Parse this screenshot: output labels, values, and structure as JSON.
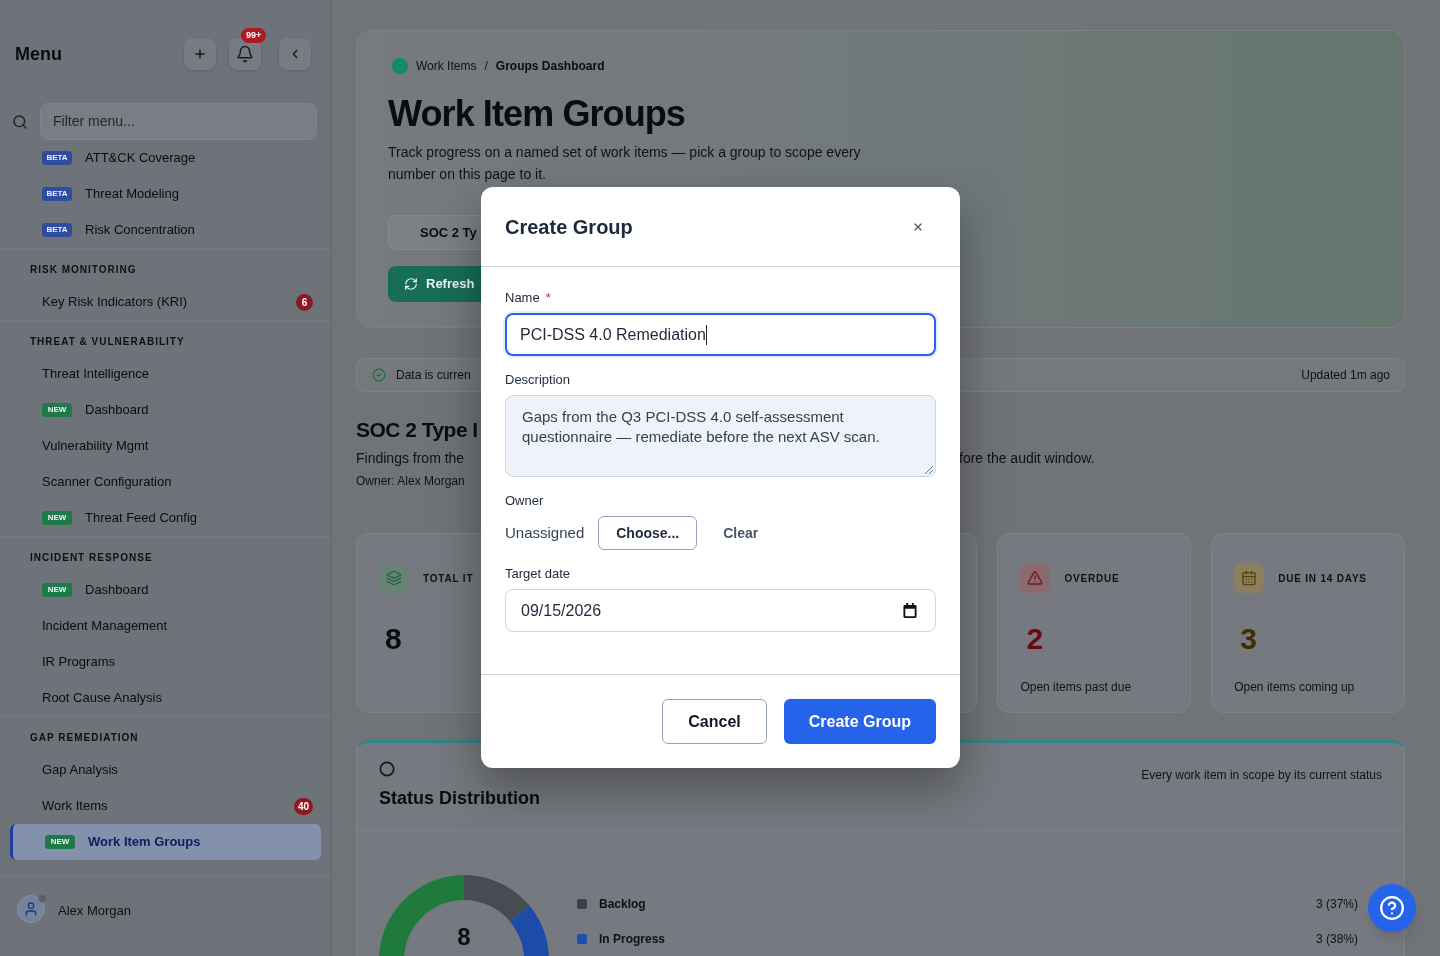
{
  "sidebar": {
    "title": "Menu",
    "notification_count": "99+",
    "filter": {
      "placeholder": "Filter menu..."
    },
    "sections": [
      {
        "items": [
          {
            "label": "ATT&CK Coverage",
            "tag": {
              "text": "BETA",
              "color": "#2f4d9f"
            },
            "selected": false
          },
          {
            "label": "Threat Modeling",
            "tag": {
              "text": "BETA",
              "color": "#2f4d9f"
            },
            "selected": false
          },
          {
            "label": "Risk Concentration",
            "tag": {
              "text": "BETA",
              "color": "#2f4d9f"
            },
            "selected": false
          }
        ]
      },
      {
        "heading": "RISK MONITORING",
        "items": [
          {
            "label": "Key Risk Indicators (KRI)",
            "count": "6",
            "selected": false
          }
        ]
      },
      {
        "heading": "THREAT & VULNERABILITY",
        "items": [
          {
            "label": "Threat Intelligence",
            "selected": false
          },
          {
            "label": "Dashboard",
            "tag": {
              "text": "NEW",
              "color": "#1e7a48"
            },
            "selected": false
          },
          {
            "label": "Vulnerability Mgmt",
            "selected": false
          },
          {
            "label": "Scanner Configuration",
            "selected": false
          },
          {
            "label": "Threat Feed Config",
            "tag": {
              "text": "NEW",
              "color": "#1e7a48"
            },
            "selected": false
          }
        ]
      },
      {
        "heading": "INCIDENT RESPONSE",
        "items": [
          {
            "label": "Dashboard",
            "tag": {
              "text": "NEW",
              "color": "#1e7a48"
            },
            "selected": false
          },
          {
            "label": "Incident Management",
            "selected": false
          },
          {
            "label": "IR Programs",
            "selected": false
          },
          {
            "label": "Root Cause Analysis",
            "selected": false
          }
        ]
      },
      {
        "heading": "GAP REMEDIATION",
        "items": [
          {
            "label": "Gap Analysis",
            "selected": false
          },
          {
            "label": "Work Items",
            "count": "40",
            "selected": false
          },
          {
            "label": "Work Item Groups",
            "tag": {
              "text": "NEW",
              "color": "#1e7a48"
            },
            "selected": true
          }
        ]
      }
    ],
    "user": {
      "name": "Alex Morgan"
    }
  },
  "main": {
    "breadcrumb": {
      "items": [
        "Work Items",
        "Groups Dashboard"
      ],
      "separator": "/"
    },
    "title": "Work Item Groups",
    "description": "Track progress on a named set of work items — pick a group to scope every number on this page to it.",
    "group_select": {
      "value": "SOC 2 Ty"
    },
    "refresh_button": {
      "label": "Refresh"
    },
    "status": {
      "message": "Data is curren",
      "updated": "Updated 1m ago"
    },
    "group": {
      "title": "SOC 2 Type I",
      "description_start": "Findings from the",
      "description_end": "fore the audit window.",
      "owner": "Owner: Alex Morgan"
    },
    "stat_cards": [
      {
        "kind": "total",
        "label": "TOTAL IT",
        "value": "8"
      },
      {
        "kind": "overdue",
        "label": "OVERDUE",
        "value": "2",
        "caption": "Open items past due"
      },
      {
        "kind": "due_soon",
        "label": "DUE IN 14 DAYS",
        "value": "3",
        "caption": "Open items coming up"
      }
    ],
    "status_distribution": {
      "title": "Status Distribution",
      "subtitle": "Every work item in scope by its current status",
      "total": "8",
      "legend": [
        {
          "label": "Backlog",
          "value": "3 (37%)",
          "color": "#3d4148"
        },
        {
          "label": "In Progress",
          "value": "3 (38%)",
          "color": "#1f4fae"
        }
      ]
    }
  },
  "modal": {
    "title": "Create Group",
    "fields": [
      {
        "kind": "text",
        "label": "Name",
        "required_mark": "*",
        "value": "PCI-DSS 4.0 Remediation",
        "focused": true
      },
      {
        "kind": "textarea",
        "label": "Description",
        "value": "Gaps from the Q3 PCI-DSS 4.0 self-assessment questionnaire — remediate before the next ASV scan."
      },
      {
        "kind": "owner",
        "label": "Owner",
        "value": "Unassigned",
        "choose_button": "Choose...",
        "clear_button": "Clear"
      },
      {
        "kind": "date",
        "label": "Target date",
        "value": "09/15/2026"
      }
    ],
    "buttons": [
      {
        "kind": "secondary",
        "label": "Cancel"
      },
      {
        "kind": "primary",
        "label": "Create Group"
      }
    ]
  }
}
